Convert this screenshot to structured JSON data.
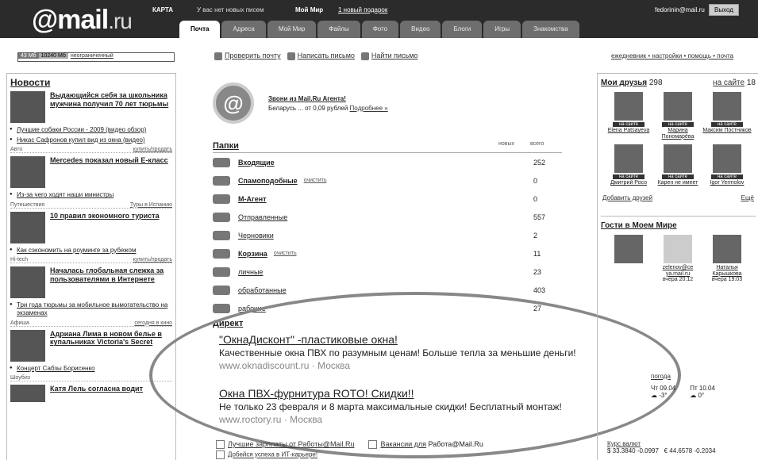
{
  "header": {
    "logo": "@mail",
    "logo_ru": ".ru",
    "map": "КАРТА",
    "no_new_letters": "У вас нет новых писем",
    "my_world": "Мой Мир",
    "new_gift": "1 новый подарок",
    "user": "fedorinin@mail.ru",
    "exit": "Выход"
  },
  "tabs": [
    "Почта",
    "Адреса",
    "Мой Мир",
    "Файлы",
    "Фото",
    "Видео",
    "Блоги",
    "Игры",
    "Знакомства"
  ],
  "quota": {
    "used": "43 Мб",
    "total": "10240 Мб",
    "label": "неограниченный"
  },
  "actions": [
    "Проверить почту",
    "Написать письмо",
    "Найти письмо"
  ],
  "top_right": "ежедневник • настройки • помощь • почта",
  "news": {
    "heading": "Новости",
    "items": [
      {
        "title": "Выдающийся себя за школьника мужчина получил 70 лет тюрьмы",
        "bullets": [
          "Лучшие собаки России - 2009 (видео обзор)",
          "Никас Сафронов купил вид из окна (видео)"
        ]
      },
      {
        "section": "Авто",
        "section_link": "купить/продать",
        "title": "Mercedes показал новый E-класс",
        "bullets": [
          "Из-за чего ходят наши министры"
        ]
      },
      {
        "section": "Путешествия",
        "section_link": "Туры в Испанию",
        "title": "10 правил экономного туриста",
        "bullets": [
          "Как сэкономить на роуминге за рубежом"
        ]
      },
      {
        "section": "Hi-tech",
        "section_link": "купить/продать",
        "title": "Началась глобальная слежка за пользователями в Интернете",
        "bullets": [
          "Три года тюрьмы за мобильное вымогательство на экзаменах"
        ]
      },
      {
        "section": "Афиша",
        "section_link": "сегодня в кино",
        "title": "Адриана Лима в новом белье в купальниках Victoria's Secret",
        "bullets": [
          "Концерт Сабзы Борисенко"
        ]
      },
      {
        "section": "Шоубиз",
        "section_link": "",
        "title": "Катя Лель согласна водит",
        "bullets": []
      }
    ]
  },
  "promo": {
    "title": "Звони из Mail.Ru Агента!",
    "text": "Беларусь ... от 0,09 рублей",
    "more": "Подробнее »"
  },
  "folders": {
    "heading": "Папки",
    "col_new": "новых",
    "col_total": "всего",
    "rows": [
      {
        "name": "Входящие",
        "count": "252",
        "bold": true,
        "clear": ""
      },
      {
        "name": "Спамоподобные",
        "count": "0",
        "bold": true,
        "clear": "очистить"
      },
      {
        "name": "M-Агент",
        "count": "0",
        "bold": true,
        "clear": ""
      },
      {
        "name": "Отправленные",
        "count": "557",
        "bold": true,
        "clear": ""
      },
      {
        "name": "Черновики",
        "count": "2",
        "bold": true,
        "clear": ""
      },
      {
        "name": "Корзина",
        "count": "11",
        "bold": true,
        "clear": "очистить"
      },
      {
        "name": "личные",
        "count": "23",
        "bold": false,
        "clear": ""
      },
      {
        "name": "обработанные",
        "count": "403",
        "bold": false,
        "clear": ""
      },
      {
        "name": "рабочие",
        "count": "27",
        "bold": false,
        "clear": ""
      }
    ]
  },
  "ads": {
    "heading": "Директ",
    "items": [
      {
        "title": "\"ОкнаДисконт\" -пластиковые окна!",
        "desc": "Качественные окна ПВХ по разумным ценам! Больше тепла за меньшие деньги!",
        "url": "www.oknadiscount.ru",
        "city": "Москва"
      },
      {
        "title": "Окна ПВХ-фурнитура ROTO! Скидки!!",
        "desc": "Не только 23 февраля и 8 марта максимальные скидки! Бесплатный монтаж!",
        "url": "www.roctory.ru",
        "city": "Москва"
      }
    ]
  },
  "bottom": {
    "link1": "Лучшие зарплаты от Работы@Mail.Ru",
    "link2": "Вакансии для",
    "link3": "Работа@Mail.Ru",
    "link4": "Добейся успеха в ИТ-карьере!"
  },
  "friends": {
    "heading": "Мои друзья",
    "count": "298",
    "on_site": "на сайте",
    "on_site_count": "18",
    "online": "на сайте",
    "list": [
      "Elena Patsayeva",
      "Марина Пономарёва",
      "Максим Постников",
      "Дмитрий Росо",
      "Карен не имеет",
      "Igor Yermolov"
    ],
    "add": "Добавить друзей",
    "all": "Ещё"
  },
  "guests": {
    "heading": "Гости в Моем Мире",
    "list": [
      {
        "name": "",
        "time": ""
      },
      {
        "name": "zelenov@ce ya.mail.ru",
        "time": "вчера 20:12"
      },
      {
        "name": "Наталья Карышкова",
        "time": "вчера 19:03"
      }
    ]
  },
  "weather": {
    "label": "погода",
    "d1": "Чт 09.04",
    "t1": "-3°",
    "d2": "Пт 10.04",
    "t2": "0°"
  },
  "rates": {
    "label": "Курс валют",
    "usd": "$ 33.3840 -0.0997",
    "eur": "€ 44.6578 -0.2034"
  }
}
